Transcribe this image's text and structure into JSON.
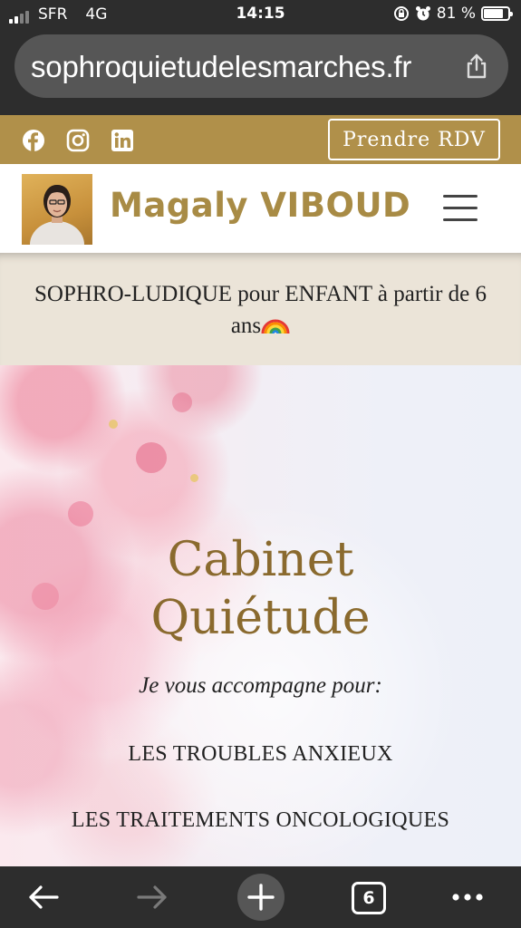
{
  "status": {
    "carrier": "SFR",
    "network": "4G",
    "time": "14:15",
    "battery_text": "81 %",
    "battery_level": 0.81
  },
  "browser": {
    "url": "sophroquietudelesmarches.fr",
    "tab_count": "6"
  },
  "topbar": {
    "social": [
      "facebook-icon",
      "instagram-icon",
      "linkedin-icon"
    ],
    "cta_label": "Prendre RDV"
  },
  "header": {
    "brand": "Magaly VIBOUD"
  },
  "announcement": {
    "text": "SOPHRO-LUDIQUE pour ENFANT à partir de 6 ans"
  },
  "hero": {
    "title_line1": "Cabinet",
    "title_line2": "Quiétude",
    "subtitle": "Je vous accompagne pour:",
    "items": [
      "LES TROUBLES ANXIEUX",
      "LES TRAITEMENTS ONCOLOGIQUES"
    ]
  },
  "colors": {
    "gold": "#b0904a",
    "brand_text": "#a88b45",
    "title_brown": "#8a6a2e",
    "announce_bg": "#ebe4d8",
    "chrome": "#2d2d2d"
  }
}
